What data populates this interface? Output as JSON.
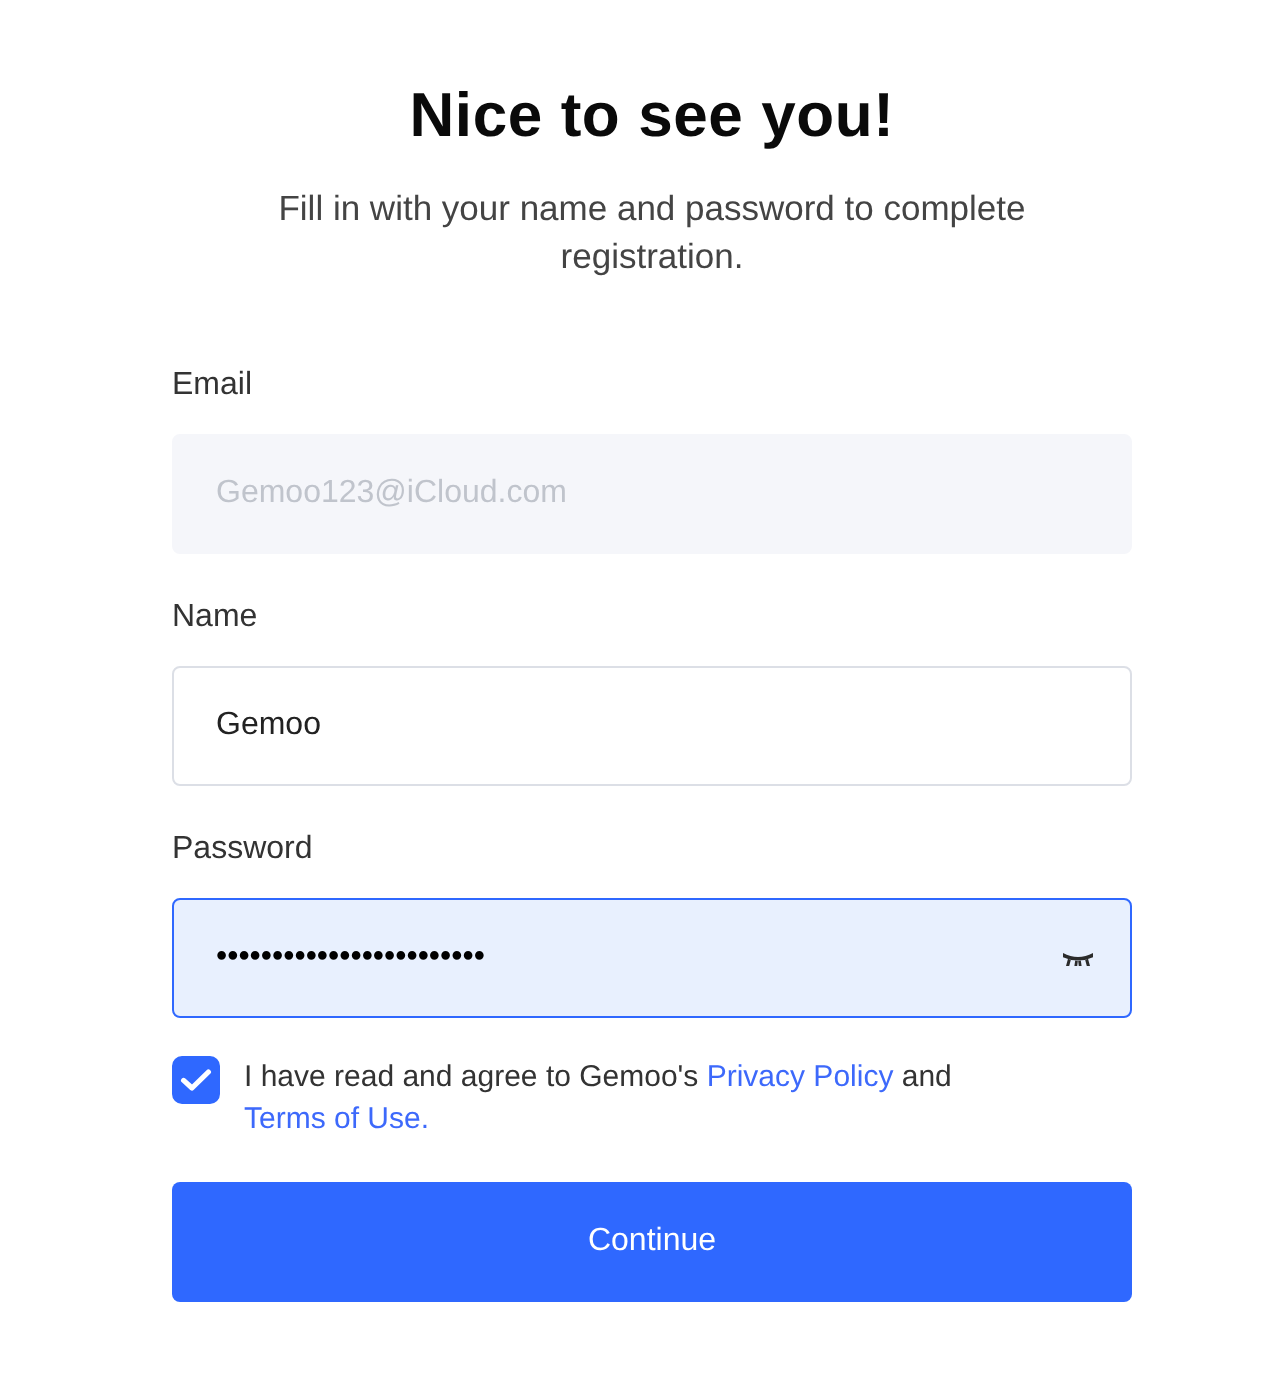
{
  "header": {
    "title": "Nice to see you!",
    "subtitle": "Fill in with your name and password to complete registration."
  },
  "fields": [
    {
      "kind": "text",
      "label": "Email",
      "value": "Gemoo123@iCloud.com",
      "disabled": true,
      "focused": false
    },
    {
      "kind": "text",
      "label": "Name",
      "value": "Gemoo",
      "disabled": false,
      "focused": false
    },
    {
      "kind": "password",
      "label": "Password",
      "value": "••••••••••••••••••••••••",
      "disabled": false,
      "focused": true
    }
  ],
  "agreement": {
    "checked": true,
    "parts": [
      {
        "kind": "text",
        "text": "I have read and agree to Gemoo's "
      },
      {
        "kind": "link",
        "text": "Privacy Policy"
      },
      {
        "kind": "text",
        "text": " and "
      },
      {
        "kind": "link",
        "text": "Terms of Use."
      }
    ]
  },
  "button": {
    "label": "Continue"
  }
}
